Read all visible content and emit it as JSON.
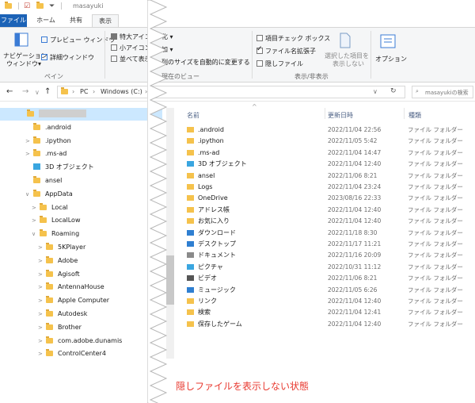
{
  "window": {
    "title": "masayuki",
    "colors": {
      "accent": "#1c63b7",
      "folder": "#f5c24c",
      "selection": "#cce8ff",
      "caption": "#e8392f"
    }
  },
  "tabs": [
    {
      "label": "ファイル"
    },
    {
      "label": "ホーム"
    },
    {
      "label": "共有"
    },
    {
      "label": "表示"
    }
  ],
  "ribbon": {
    "nav_pane": "ナビゲーション",
    "nav_pane2": "ウィンドウ▾",
    "preview": "プレビュー ウィンドウ",
    "details": "詳細ウィンドウ",
    "pane_group": "ペイン",
    "large_icons": "特大アイコン",
    "small_icons": "小アイコン",
    "list": "並べて表示",
    "cut1": "化 ▾",
    "cut2": "加 ▾",
    "fit_columns": "列のサイズを自動的に変更する",
    "view_group": "現在のビュー",
    "item_checkboxes": "項目チェック ボックス",
    "file_extensions": "ファイル名拡張子",
    "hidden_items": "隠しファイル",
    "hide_selected_1": "選択した項目を",
    "hide_selected_2": "表示しない",
    "showhide_group": "表示/非表示",
    "options": "オプション"
  },
  "address": {
    "back": "←",
    "forward": "→",
    "history": "∨",
    "up": "↑",
    "crumb_pc": "PC",
    "crumb_drive": "Windows (C:)",
    "crumb_more": "›",
    "refresh_icon": "refresh-icon",
    "search_placeholder": "masayukiの検索"
  },
  "tree": [
    {
      "label": "",
      "blurred": true,
      "icon": "folder"
    },
    {
      "label": ".android",
      "icon": "folder"
    },
    {
      "label": ".ipython",
      "icon": "folder",
      "arrow": ">"
    },
    {
      "label": ".ms-ad",
      "icon": "folder",
      "arrow": ">"
    },
    {
      "label": "3D オブジェクト",
      "icon": "3d-objects"
    },
    {
      "label": "ansel",
      "icon": "folder"
    },
    {
      "label": "AppData",
      "icon": "folder",
      "arrow": "∨"
    },
    {
      "label": "Local",
      "icon": "folder",
      "arrow": ">"
    },
    {
      "label": "LocalLow",
      "icon": "folder",
      "arrow": ">"
    },
    {
      "label": "Roaming",
      "icon": "folder",
      "arrow": "∨"
    },
    {
      "label": "5KPlayer",
      "icon": "folder",
      "arrow": ">"
    },
    {
      "label": "Adobe",
      "icon": "folder",
      "arrow": ">"
    },
    {
      "label": "Agisoft",
      "icon": "folder",
      "arrow": ">"
    },
    {
      "label": "AntennaHouse",
      "icon": "folder",
      "arrow": ">"
    },
    {
      "label": "Apple Computer",
      "icon": "folder",
      "arrow": ">"
    },
    {
      "label": "Autodesk",
      "icon": "folder",
      "arrow": ">"
    },
    {
      "label": "Brother",
      "icon": "folder",
      "arrow": ">"
    },
    {
      "label": "com.adobe.dunamis",
      "icon": "folder",
      "arrow": ">"
    },
    {
      "label": "ControlCenter4",
      "icon": "folder",
      "arrow": ">"
    }
  ],
  "columns": {
    "name": "名前",
    "date": "更新日時",
    "type": "種類"
  },
  "files": [
    {
      "name": ".android",
      "date": "2022/11/04 22:56",
      "type": "ファイル フォルダー",
      "icon": "folder"
    },
    {
      "name": ".ipython",
      "date": "2022/11/05 5:42",
      "type": "ファイル フォルダー",
      "icon": "folder"
    },
    {
      "name": ".ms-ad",
      "date": "2022/11/04 14:47",
      "type": "ファイル フォルダー",
      "icon": "folder"
    },
    {
      "name": "3D オブジェクト",
      "date": "2022/11/04 12:40",
      "type": "ファイル フォルダー",
      "icon": "3d-objects"
    },
    {
      "name": "ansel",
      "date": "2022/11/06 8:21",
      "type": "ファイル フォルダー",
      "icon": "folder"
    },
    {
      "name": "Logs",
      "date": "2022/11/04 23:24",
      "type": "ファイル フォルダー",
      "icon": "folder"
    },
    {
      "name": "OneDrive",
      "date": "2023/08/16 22:33",
      "type": "ファイル フォルダー",
      "icon": "folder"
    },
    {
      "name": "アドレス帳",
      "date": "2022/11/04 12:40",
      "type": "ファイル フォルダー",
      "icon": "contacts"
    },
    {
      "name": "お気に入り",
      "date": "2022/11/04 12:40",
      "type": "ファイル フォルダー",
      "icon": "favorites"
    },
    {
      "name": "ダウンロード",
      "date": "2022/11/18 8:30",
      "type": "ファイル フォルダー",
      "icon": "downloads"
    },
    {
      "name": "デスクトップ",
      "date": "2022/11/17 11:21",
      "type": "ファイル フォルダー",
      "icon": "desktop"
    },
    {
      "name": "ドキュメント",
      "date": "2022/11/16 20:09",
      "type": "ファイル フォルダー",
      "icon": "documents"
    },
    {
      "name": "ピクチャ",
      "date": "2022/10/31 11:12",
      "type": "ファイル フォルダー",
      "icon": "pictures"
    },
    {
      "name": "ビデオ",
      "date": "2022/11/06 8:21",
      "type": "ファイル フォルダー",
      "icon": "videos"
    },
    {
      "name": "ミュージック",
      "date": "2022/11/05 6:26",
      "type": "ファイル フォルダー",
      "icon": "music"
    },
    {
      "name": "リンク",
      "date": "2022/11/04 12:40",
      "type": "ファイル フォルダー",
      "icon": "links"
    },
    {
      "name": "検索",
      "date": "2022/11/04 12:41",
      "type": "ファイル フォルダー",
      "icon": "searches"
    },
    {
      "name": "保存したゲーム",
      "date": "2022/11/04 12:40",
      "type": "ファイル フォルダー",
      "icon": "saved-games"
    }
  ],
  "caption": "隠しファイルを表示しない状態"
}
